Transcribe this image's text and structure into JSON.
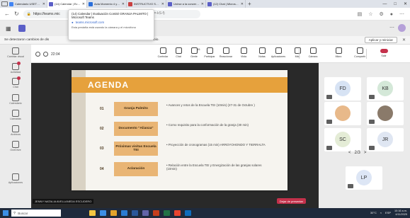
{
  "browser": {
    "tabs": [
      {
        "label": "Calendario USETT R...",
        "favicon_color": "#4285f4",
        "active": false
      },
      {
        "label": "(14) Calendar | Eva...",
        "favicon_color": "#5b5fc7",
        "active": true
      },
      {
        "label": "Acta Momento 4 y 5...",
        "favicon_color": "#2a6fdb",
        "active": false
      },
      {
        "label": "INSTRUCTIVO SOLUCI...",
        "favicon_color": "#c94040",
        "active": false
      },
      {
        "label": "Unirse a la conversaci...",
        "favicon_color": "#5b5fc7",
        "active": false
      },
      {
        "label": "(12) Chat | Microsoft T...",
        "favicon_color": "#5b5fc7",
        "active": false
      }
    ],
    "new_tab": "+",
    "window_controls": [
      "—",
      "□",
      "✕"
    ],
    "url": "https://teams.mic",
    "url_tail": "(id=-kS-f)",
    "nav": {
      "back": "←",
      "refresh": "↻"
    }
  },
  "popup": {
    "title": "(14) Calendar | Evaluación Comité GRANJA PALMITO | Microsoft Teams",
    "domain": "teams.microsoft.com",
    "note": "Esta pestaña está usando la cámara y el micrófono"
  },
  "notification": {
    "message": "Se detectaron cambios de dis",
    "message2": "ibio.",
    "update_button": "Aplicar y reiniciar",
    "close": "✕"
  },
  "rail": [
    {
      "label": "Cambiar visual",
      "badge": false
    },
    {
      "label": "Actividad",
      "badge": true
    },
    {
      "label": "Chat",
      "badge": true
    },
    {
      "label": "Calendario",
      "badge": false
    },
    {
      "label": "Llamadas",
      "badge": false
    },
    {
      "label": "Archivos",
      "badge": false
    },
    {
      "label": "OneDrive",
      "badge": false
    },
    {
      "label": "Aplicaciones",
      "badge": false
    }
  ],
  "meeting": {
    "timer": "22:04",
    "tools": [
      {
        "label": "Controlar"
      },
      {
        "label": "Chat"
      },
      {
        "label": "Gente",
        "count": "15"
      },
      {
        "label": "Participar"
      },
      {
        "label": "Reaccionar"
      },
      {
        "label": "Vista"
      },
      {
        "label": "Notas"
      },
      {
        "label": "Aplicaciones"
      },
      {
        "label": "Más"
      },
      {
        "label": "Cámara"
      },
      {
        "label": "Micro"
      },
      {
        "label": "Compartir"
      },
      {
        "label": "Salir"
      }
    ]
  },
  "slide": {
    "title": "AGENDA",
    "rows": [
      {
        "num": "01",
        "topic": "Granja Palmito",
        "desc": "• Avances y retos de la Escuela TEI (10min) (27-31 de Octubre )"
      },
      {
        "num": "02",
        "topic": "Documento \"Alianza\"",
        "desc": "• Como requisito para la conformación de la granja (30 min)"
      },
      {
        "num": "03",
        "topic": "Próximas visitas Escuela TEI",
        "desc": "• Proyección de cronogramas (15 min) ARROYOHONDO Y TIERRALTA"
      },
      {
        "num": "04",
        "topic": "Aclaración",
        "desc": "• Relación entre la Escuela TEI y Energización de las granjas solares (10min)"
      }
    ]
  },
  "presenter": "JENNY NATALIA AVELLANEDA ESCUDERO",
  "stop_presenting": "Dejar de presentar",
  "participants": [
    {
      "initials": "FD",
      "color": "#d7e3f4",
      "photo": false
    },
    {
      "initials": "KB",
      "color": "#d4e8d8",
      "photo": false
    },
    {
      "initials": "",
      "color": "#e8b98a",
      "photo": true
    },
    {
      "initials": "",
      "color": "#8a7a6a",
      "photo": true
    },
    {
      "initials": "SC",
      "color": "#e4ecd6",
      "photo": false
    },
    {
      "initials": "JR",
      "color": "#dfe6f2",
      "photo": false
    },
    {
      "initials": "LP",
      "color": "#dde6f5",
      "photo": false
    }
  ],
  "pagination": {
    "prev": "<",
    "text": "2/3",
    "next": ">"
  },
  "taskbar": {
    "search": "Buscar",
    "weather": "30°C",
    "language": "ESP",
    "time": "10:16 a.m.",
    "date": "4/11/2025"
  }
}
